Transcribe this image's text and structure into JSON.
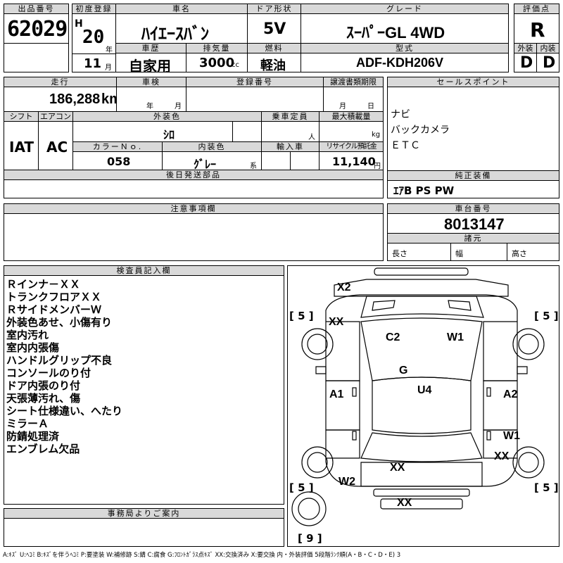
{
  "header": {
    "lot_label": "出品番号",
    "lot": "62029",
    "first_reg_label": "初度登録",
    "era": "H",
    "year_num": "20",
    "year_unit": "年",
    "month_num": "11",
    "month_unit": "月",
    "name_label": "車名",
    "name": "ﾊｲｴｰｽﾊﾞﾝ",
    "door_label": "ドア形状",
    "door": "5V",
    "grade_label": "グレード",
    "grade": "ｽｰﾊﾟｰGL 4WD",
    "score_label": "評価点",
    "score": "R",
    "history_label": "車歴",
    "history": "自家用",
    "disp_label": "排気量",
    "disp": "3000",
    "disp_unit": "cc",
    "fuel_label": "燃料",
    "fuel": "軽油",
    "model_label": "型式",
    "model": "ADF-KDH206V",
    "ext_label": "外装",
    "ext": "D",
    "int_label": "内装",
    "int": "D"
  },
  "row2": {
    "mileage_label": "走行",
    "mileage": "186,288",
    "mileage_unit": "km",
    "inspect_label": "車検",
    "year_unit": "年",
    "month_unit": "月",
    "reg_label": "登録番号",
    "transfer_label": "譲渡書類期限",
    "t_month": "月",
    "t_day": "日",
    "sales_label": "セールスポイント",
    "sales": [
      "ナビ",
      "バックカメラ",
      "ＥＴＣ"
    ],
    "shift_label": "シフト",
    "shift": "IAT",
    "ac_label": "エアコン",
    "ac": "AC",
    "color_label": "外装色",
    "color": "ｼﾛ",
    "cap_label": "乗車定員",
    "cap_unit": "人",
    "load_label": "最大積載量",
    "load_unit": "kg",
    "color_no_label": "カラーＮｏ.",
    "color_no": "058",
    "int_color_label": "内装色",
    "int_color": "ｸﾞﾚｰ",
    "int_color_suffix": "系",
    "import_label": "輸入車",
    "recycle_label": "リサイクル預託金",
    "recycle": "11,140",
    "recycle_unit": "円",
    "later_label": "後日発送部品",
    "equip_label": "純正装備",
    "equip": "ｴｱB PS PW"
  },
  "row3": {
    "caution_label": "注意事項欄",
    "chassis_label": "車台番号",
    "chassis": "8013147",
    "spec_label": "諸元",
    "length_label": "長さ",
    "width_label": "幅",
    "height_label": "高さ"
  },
  "inspector": {
    "label": "検査員記入欄",
    "notes": [
      "Ｒインナ－ＸＸ",
      "トランクフロアＸＸ",
      "ＲサイドメンバーＷ",
      "外装色あせ、小傷有り",
      "室内汚れ",
      "室内内張傷",
      "ハンドルグリップ不良",
      "コンソールのり付",
      "ドア内張のり付",
      "天張薄汚れ、傷",
      "シート仕様違い、へたり",
      "ミラーＡ",
      "防錆処理済",
      "エンブレム欠品"
    ]
  },
  "diagram": {
    "marks": {
      "x2": "X2",
      "xx_fl": "XX",
      "c2": "C2",
      "w1_top": "W1",
      "g": "G",
      "u4": "U4",
      "a1": "A1",
      "a2": "A2",
      "w1_r": "W1",
      "xx_r": "XX",
      "xx_c": "XX",
      "w2": "W2",
      "xx_b": "XX"
    },
    "tire_fl": "[ 5 ]",
    "tire_fr": "[ 5 ]",
    "tire_rl": "[ 5 ]",
    "tire_rr": "[ 5 ]",
    "spare": "[ 9 ]"
  },
  "office": {
    "label": "事務局よりご案内"
  },
  "legend": "A:ｷｽﾞ U:ﾍｺﾐ B:ｷｽﾞを伴うﾍｺﾐ P:要塗装 W:補修跡 S:錆 C:腐食 G:ﾌﾛﾝﾄｶﾞﾗｽ点ｷｽﾞ XX:交換済み X:要交換 内・外装評価 5段階ﾗﾝｸ順(A・B・C・D・E) 3"
}
